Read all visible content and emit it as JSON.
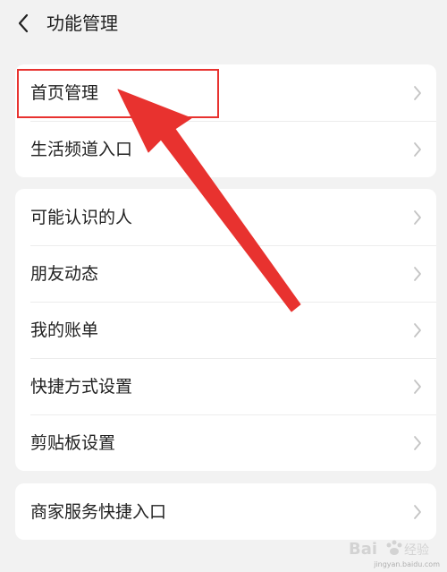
{
  "header": {
    "title": "功能管理",
    "back_icon": "chevron-left-icon"
  },
  "groups": [
    {
      "items": [
        {
          "label": "首页管理"
        },
        {
          "label": "生活频道入口"
        }
      ]
    },
    {
      "items": [
        {
          "label": "可能认识的人"
        },
        {
          "label": "朋友动态"
        },
        {
          "label": "我的账单"
        },
        {
          "label": "快捷方式设置"
        },
        {
          "label": "剪贴板设置"
        }
      ]
    },
    {
      "items": [
        {
          "label": "商家服务快捷入口"
        }
      ]
    }
  ],
  "annotation": {
    "arrow_color": "#e8322f",
    "box_color": "#e8322f"
  },
  "watermark": {
    "text": "jingyan.baidu.com"
  }
}
